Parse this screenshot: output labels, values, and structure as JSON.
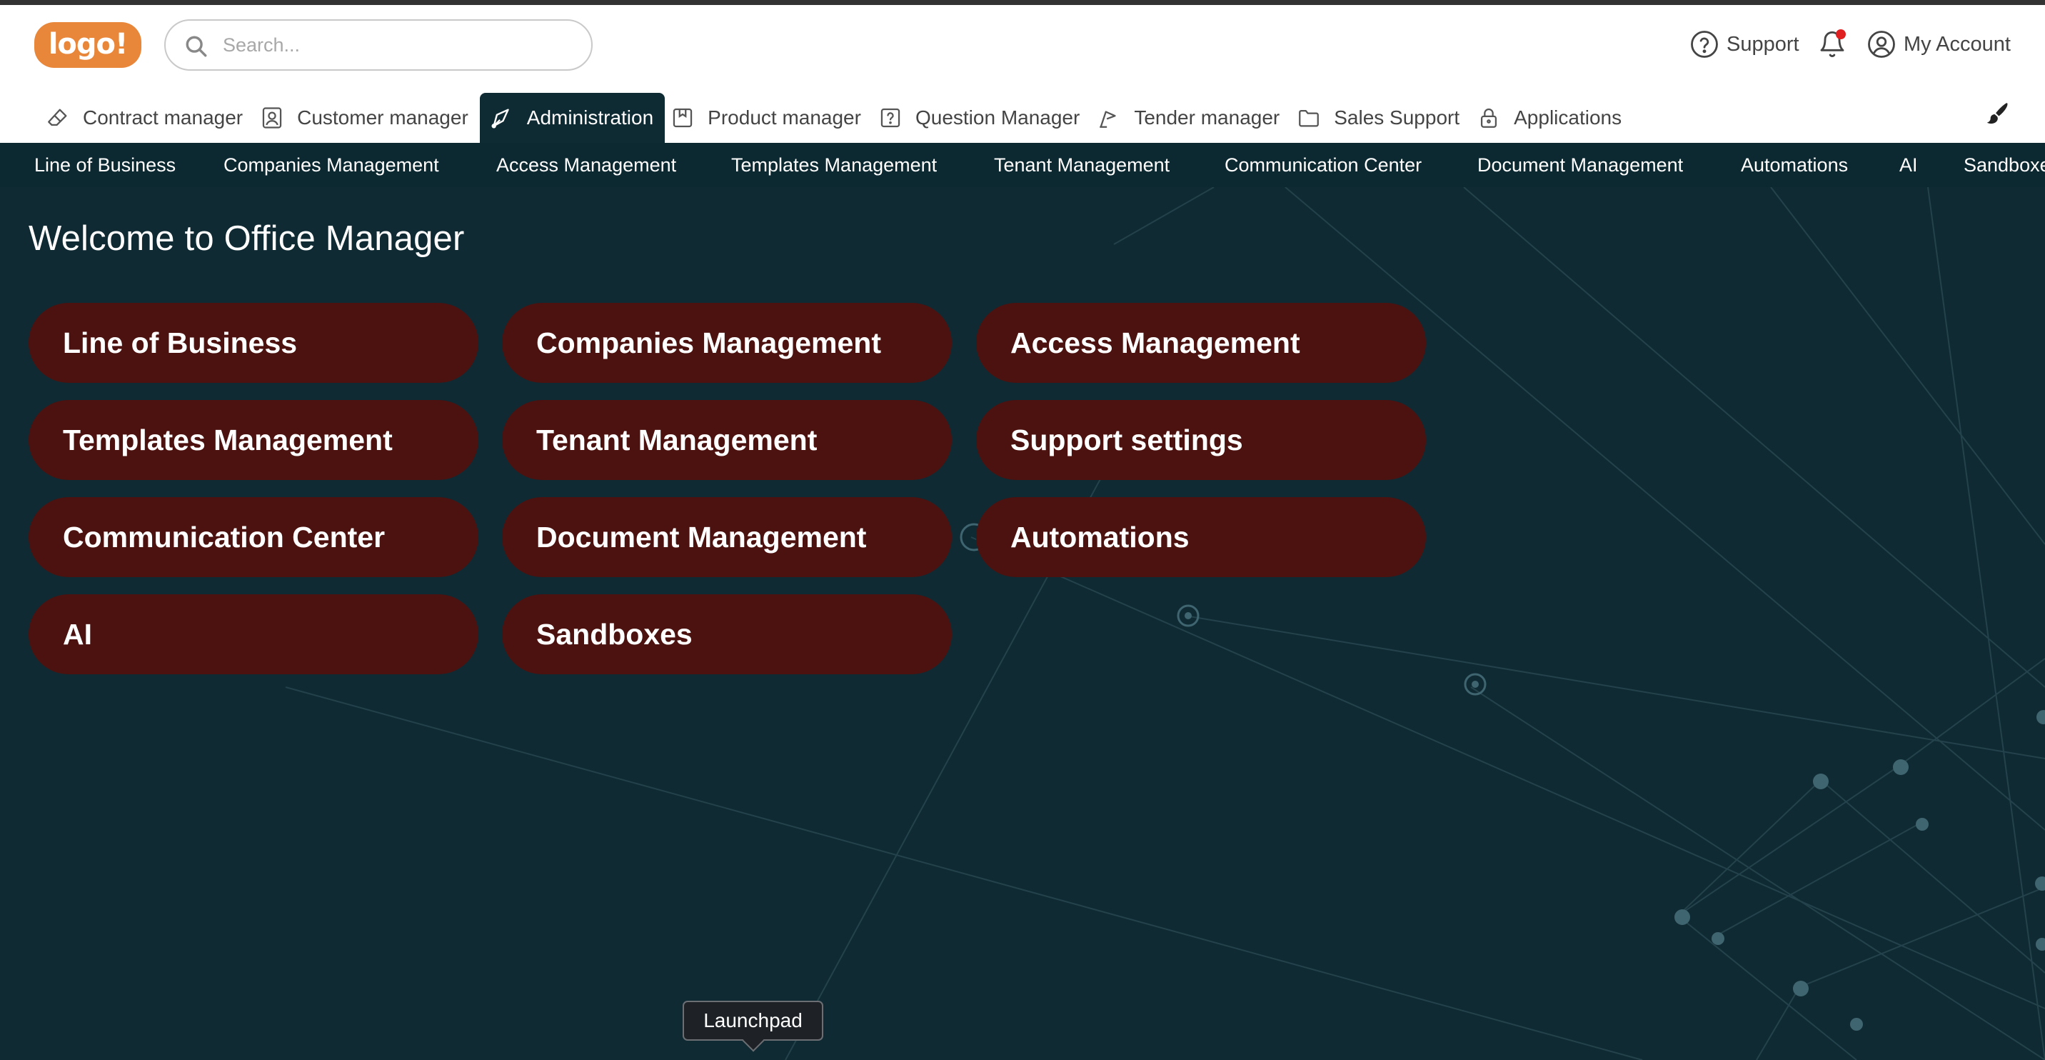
{
  "brand": {
    "logo_text": "logo!",
    "accent": "#e8863a"
  },
  "search": {
    "placeholder": "Search..."
  },
  "header_right": {
    "support_label": "Support",
    "account_label": "My Account",
    "notification_badge_color": "#e02020"
  },
  "tabs": [
    {
      "label": "Contract manager",
      "icon": "eraser-icon"
    },
    {
      "label": "Customer manager",
      "icon": "user-card-icon"
    },
    {
      "label": "Administration",
      "icon": "pen-tool-icon",
      "active": true
    },
    {
      "label": "Product manager",
      "icon": "bookmark-box-icon"
    },
    {
      "label": "Question Manager",
      "icon": "question-box-icon"
    },
    {
      "label": "Tender manager",
      "icon": "gavel-icon"
    },
    {
      "label": "Sales Support",
      "icon": "folder-icon"
    },
    {
      "label": "Applications",
      "icon": "lock-icon"
    }
  ],
  "subnav": [
    "Line of Business",
    "Companies Management",
    "Access Management",
    "Templates Management",
    "Tenant Management",
    "Communication Center",
    "Document Management",
    "Automations",
    "AI",
    "Sandboxes"
  ],
  "main": {
    "title": "Welcome to Office Manager",
    "tiles": [
      "Line of Business",
      "Companies Management",
      "Access Management",
      "Templates Management",
      "Tenant Management",
      "Support settings",
      "Communication Center",
      "Document Management",
      "Automations",
      "AI",
      "Sandboxes"
    ],
    "tile_color": "#4b1210",
    "background_color": "#0f2a33"
  },
  "tooltip": {
    "text": "Launchpad"
  }
}
